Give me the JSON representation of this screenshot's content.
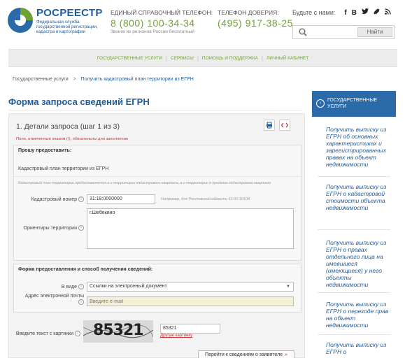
{
  "header": {
    "logo_name": "РОСРЕЕСТР",
    "logo_sub": "Федеральная служба государственной регистрации, кадастра и картографии",
    "unified_phone": {
      "label": "ЕДИНЫЙ СПРАВОЧНЫЙ ТЕЛЕФОН:",
      "number": "8 (800) 100-34-34",
      "note": "Звонок из регионов России бесплатный"
    },
    "trust_phone": {
      "label": "ТЕЛЕФОН ДОВЕРИЯ:",
      "number": "(495) 917-38-25"
    },
    "social_label": "Будьте с нами:",
    "social_icons": [
      "f",
      "B",
      "twitter-icon",
      "instagram-icon",
      "rss-icon"
    ],
    "search": {
      "placeholder": "",
      "button": "Найти"
    }
  },
  "nav": [
    "ГОСУДАРСТВЕННЫЕ УСЛУГИ",
    "СЕРВИСЫ",
    "ПОМОЩЬ И ПОДДЕРЖКА",
    "ЛИЧНЫЙ КАБИНЕТ"
  ],
  "breadcrumb": {
    "root": "Государственные услуги",
    "separator": ">",
    "current": "Получить кадастровый план территории из ЕГРН"
  },
  "page_title": "Форма запроса сведений ЕГРН",
  "form": {
    "step_title": "1. Детали запроса (шаг 1 из 3)",
    "required_note": "Поля, отмеченные знаком (!), обязательны для заполнения",
    "request_section": {
      "title": "Прошу предоставить:",
      "service": "Кадастровый план территории из ЕГРН",
      "description": "Кадастровый план территории предоставляется в о территории кадастрового квартала, в о территории в пределах кадастрового квартала",
      "cadastral_label": "Кадастровый номер",
      "cadastral_value": "31:18:0000000",
      "cadastral_hint": "Например, для Ростовской области 61:00:10104",
      "landmarks_label": "Ориентиры территории",
      "landmarks_value": "г.Шебекино"
    },
    "delivery_section": {
      "title": "Форма предоставления и способ получения сведений:",
      "type_label": "В виде",
      "type_value": "Ссылки на электронный документ",
      "email_label": "Адрес электронной почты",
      "email_placeholder": "Введите e-mail"
    },
    "captcha": {
      "label": "Введите текст с картинки",
      "image_text": "85321",
      "value": "85321",
      "other_link": "Другую картинку"
    },
    "submit": "Перейти к сведениям о заявителе"
  },
  "sidebar": {
    "heading": "ГОСУДАРСТВЕННЫЕ УСЛУГИ",
    "links": [
      "Получить выписку из ЕГРН об основных характеристиках и зарегистрированных правах на объект недвижимости",
      "Получить выписку из ЕГРН о кадастровой стоимости объекта недвижимости",
      "Получить выписку из ЕГРН о правах отдельного лица на имевшиеся (имеющиеся) у него объекты недвижимости",
      "Получить выписку из ЕГРН о переходе прав на объект недвижимости",
      "Получить выписку из ЕГРН о"
    ]
  },
  "colors": {
    "brand_blue": "#1d5b9a",
    "accent_green": "#6fa233",
    "required_red": "#c33333",
    "sidebar_head": "#2b6aa8"
  }
}
